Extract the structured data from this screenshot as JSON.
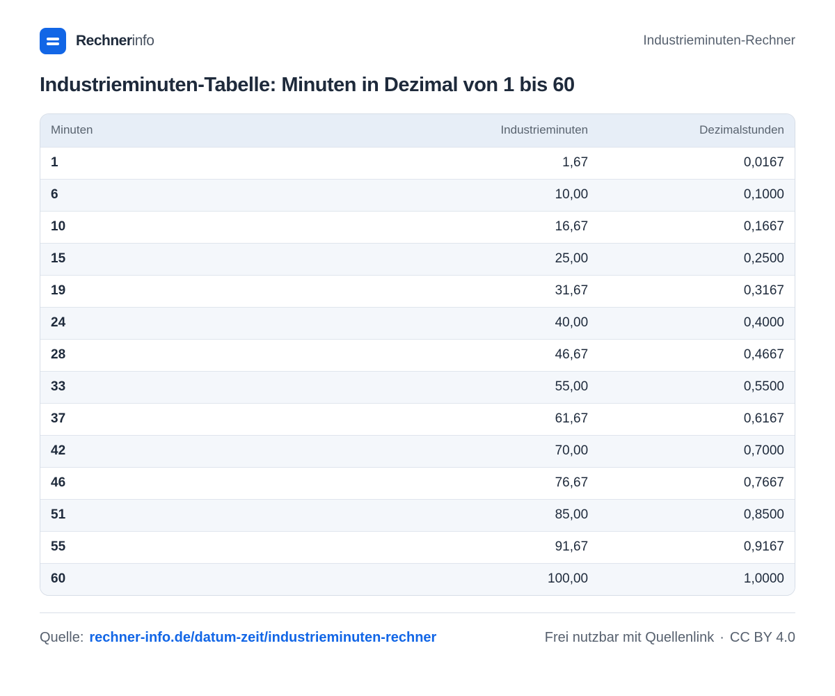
{
  "brand": {
    "name_strong": "Rechner",
    "name_light": "info"
  },
  "header": {
    "right_label": "Industrieminuten-Rechner"
  },
  "title": "Industrieminuten-Tabelle:  Minuten in Dezimal von 1 bis 60",
  "table": {
    "headers": [
      "Minuten",
      "Industrieminuten",
      "Dezimalstunden"
    ],
    "rows": [
      [
        "1",
        "1,67",
        "0,0167"
      ],
      [
        "6",
        "10,00",
        "0,1000"
      ],
      [
        "10",
        "16,67",
        "0,1667"
      ],
      [
        "15",
        "25,00",
        "0,2500"
      ],
      [
        "19",
        "31,67",
        "0,3167"
      ],
      [
        "24",
        "40,00",
        "0,4000"
      ],
      [
        "28",
        "46,67",
        "0,4667"
      ],
      [
        "33",
        "55,00",
        "0,5500"
      ],
      [
        "37",
        "61,67",
        "0,6167"
      ],
      [
        "42",
        "70,00",
        "0,7000"
      ],
      [
        "46",
        "76,67",
        "0,7667"
      ],
      [
        "51",
        "85,00",
        "0,8500"
      ],
      [
        "55",
        "91,67",
        "0,9167"
      ],
      [
        "60",
        "100,00",
        "1,0000"
      ]
    ]
  },
  "footer": {
    "source_label": "Quelle:",
    "source_link": "rechner-info.de/datum-zeit/industrieminuten-rechner",
    "usage": "Frei nutzbar mit Quellenlink",
    "separator": "·",
    "license": "CC BY 4.0"
  },
  "colors": {
    "accent": "#1266e6",
    "header_bg": "#e7eef7",
    "stripe": "#f4f7fb"
  }
}
